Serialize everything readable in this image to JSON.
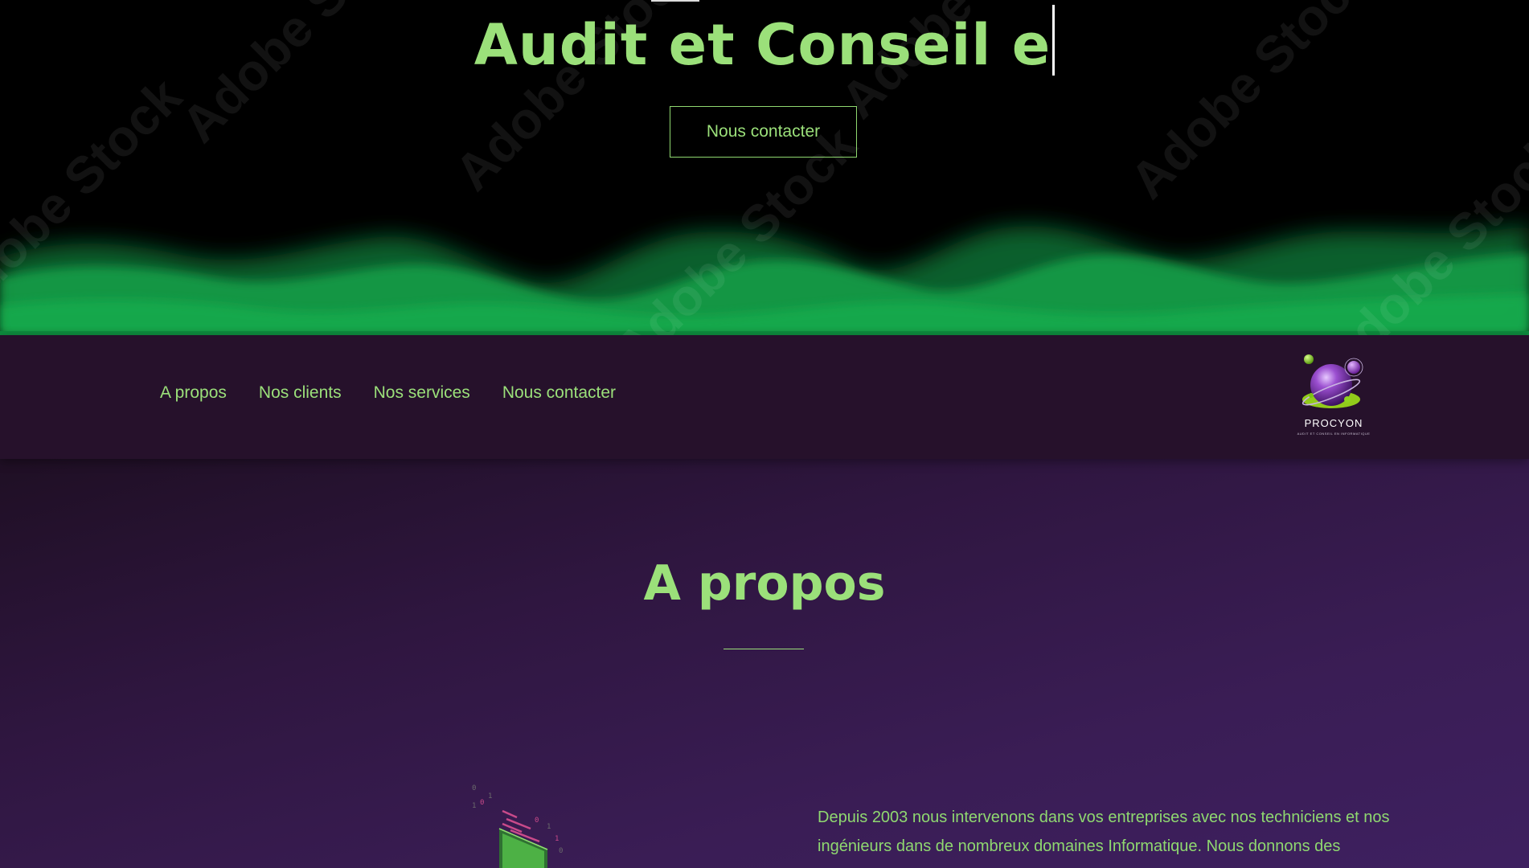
{
  "hero": {
    "title": "Audit et Conseil e",
    "cta_label": "Nous contacter",
    "watermark_text": "Adobe Stock",
    "accent_color": "#9be07a",
    "mist_color": "#0fb04a"
  },
  "nav": {
    "links": [
      {
        "label": "A propos"
      },
      {
        "label": "Nos clients"
      },
      {
        "label": "Nos services"
      },
      {
        "label": "Nous contacter"
      }
    ],
    "logo": {
      "name": "PROCYON",
      "tagline": "AUDIT ET CONSEIL EN INFORMATIQUE",
      "icon": "planet-logo-icon"
    },
    "background": "#26112b"
  },
  "about": {
    "title": "A propos",
    "paragraph_line1": "Depuis 2003 nous intervenons dans vos entreprises avec nos techniciens et nos",
    "paragraph_line2": "ingénieurs dans de nombreux domaines Informatique. Nous donnons des",
    "illustration_icon": "isometric-code-screen-icon"
  }
}
